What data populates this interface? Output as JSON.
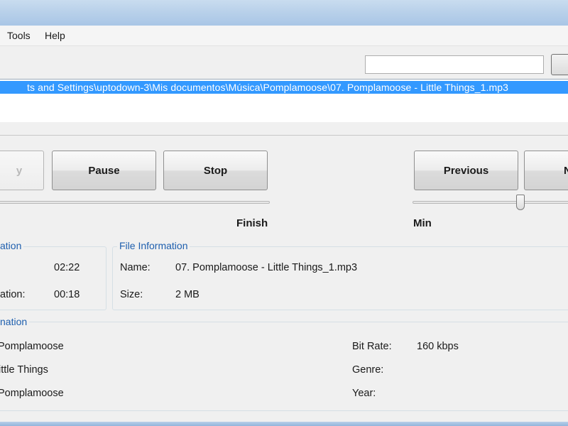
{
  "menu": {
    "tools": "Tools",
    "help": "Help"
  },
  "search": {
    "value": "",
    "button_label": ""
  },
  "playlist": {
    "rows": [
      "ts and Settings\\uptodown-3\\Mis documentos\\Música\\Pomplamoose\\07. Pomplamoose - Little Things_1.mp3"
    ]
  },
  "controls": {
    "play_label": "y",
    "pause_label": "Pause",
    "stop_label": "Stop",
    "previous_label": "Previous",
    "next_label": "N"
  },
  "position_slider": {
    "end_label": "Finish",
    "value": 0
  },
  "volume_slider": {
    "min_label": "Min",
    "value": 0.27
  },
  "time_info": {
    "legend": "ation",
    "rows": [
      {
        "label": "",
        "value": "02:22"
      },
      {
        "label": "ation:",
        "value": "00:18"
      }
    ]
  },
  "file_info": {
    "legend": "File Information",
    "name_label": "Name:",
    "name_value": "07. Pomplamoose - Little Things_1.mp3",
    "size_label": "Size:",
    "size_value": "2 MB"
  },
  "tag_info": {
    "legend": "nation",
    "left_values": [
      "Pomplamoose",
      "ittle Things",
      "Pomplamoose"
    ],
    "bitrate_label": "Bit Rate:",
    "bitrate_value": "160 kbps",
    "genre_label": "Genre:",
    "genre_value": "",
    "year_label": "Year:",
    "year_value": ""
  },
  "colors": {
    "selection": "#3399ff",
    "legend_text": "#1e5fae",
    "titlebar": "#b9d1ea"
  }
}
